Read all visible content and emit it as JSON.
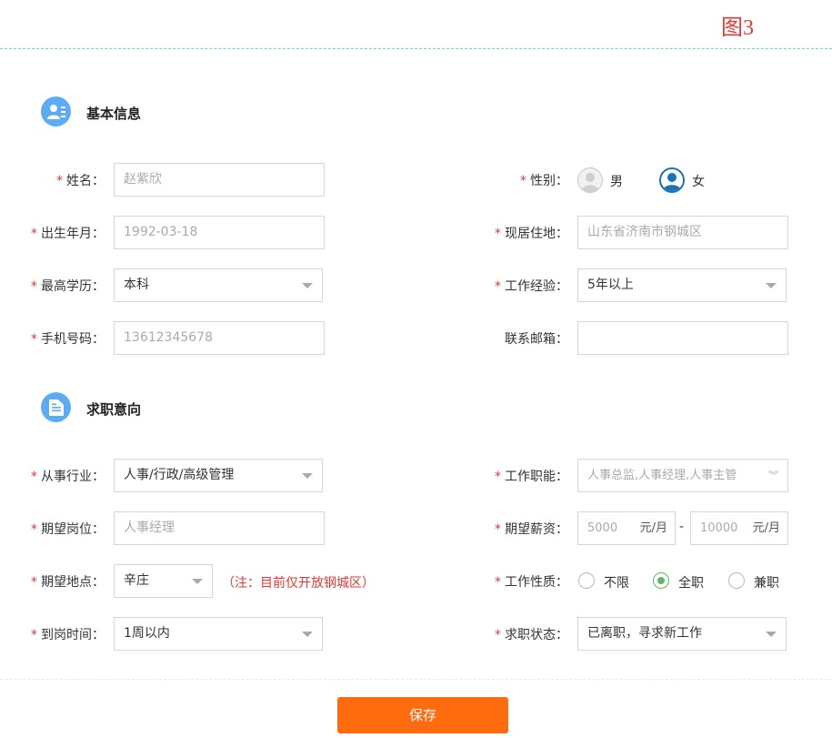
{
  "figure_label": "图3",
  "sections": {
    "basic": "基本信息",
    "intent": "求职意向"
  },
  "required_mark": "*",
  "basic": {
    "name": {
      "label": "姓名：",
      "placeholder": "赵紫欣"
    },
    "gender": {
      "label": "性别：",
      "male": "男",
      "female": "女",
      "selected": "女"
    },
    "birth": {
      "label": "出生年月：",
      "placeholder": "1992-03-18"
    },
    "residence": {
      "label": "现居住地：",
      "placeholder": "山东省济南市钢城区"
    },
    "education": {
      "label": "最高学历：",
      "value": "本科"
    },
    "experience": {
      "label": "工作经验：",
      "value": "5年以上"
    },
    "phone": {
      "label": "手机号码：",
      "placeholder": "13612345678"
    },
    "email": {
      "label": "联系邮箱：",
      "value": ""
    }
  },
  "intent": {
    "industry": {
      "label": "从事行业：",
      "value": "人事/行政/高级管理"
    },
    "function": {
      "label": "工作职能：",
      "placeholder": "人事总监,人事经理,人事主管"
    },
    "position": {
      "label": "期望岗位：",
      "placeholder": "人事经理"
    },
    "salary": {
      "label": "期望薪资：",
      "min": "5000",
      "max": "10000",
      "unit": "元/月",
      "separator": "-"
    },
    "location": {
      "label": "期望地点：",
      "value": "辛庄",
      "note": "（注：目前仅开放钢城区）"
    },
    "nature": {
      "label": "工作性质：",
      "options": [
        "不限",
        "全职",
        "兼职"
      ],
      "selected": "全职"
    },
    "arrival": {
      "label": "到岗时间：",
      "value": "1周以内"
    },
    "status": {
      "label": "求职状态：",
      "value": "已离职，寻求新工作"
    }
  },
  "save_label": "保存",
  "colors": {
    "accent": "#5cacf3",
    "required": "#e53935",
    "save": "#ff6c10",
    "radio_selected": "#5cb85c"
  }
}
